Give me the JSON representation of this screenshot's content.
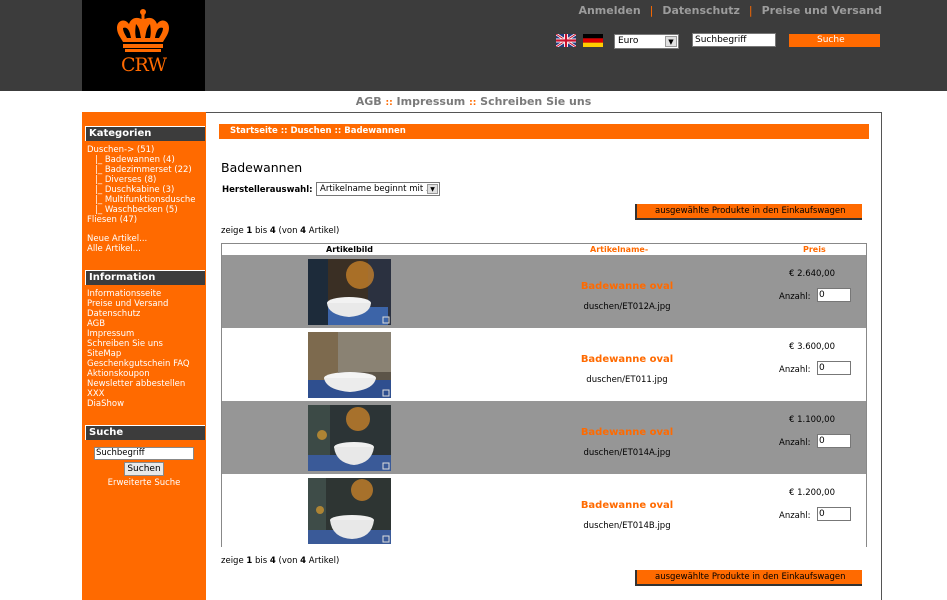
{
  "header": {
    "logo_text": "CRW",
    "top_links": [
      "Anmelden",
      "Datenschutz",
      "Preise und Versand"
    ],
    "currency": "Euro",
    "search_value": "Suchbegriff",
    "search_button": "Suche"
  },
  "secnav": {
    "links": [
      "AGB",
      "Impressum",
      "Schreiben Sie uns"
    ],
    "separator": "::"
  },
  "sidebar": {
    "categories_title": "Kategorien",
    "categories": [
      {
        "label": "Duschen-> (51)",
        "indent": false
      },
      {
        "label": "|_ Badewannen (4)",
        "indent": true
      },
      {
        "label": "|_ Badezimmerset (22)",
        "indent": true
      },
      {
        "label": "|_ Diverses (8)",
        "indent": true
      },
      {
        "label": "|_ Duschkabine (3)",
        "indent": true
      },
      {
        "label": "|_ Multifunktionsdusche",
        "indent": true
      },
      {
        "label": "|_ Waschbecken (5)",
        "indent": true
      },
      {
        "label": "Fliesen (47)",
        "indent": false
      }
    ],
    "new_products": "Neue Artikel...",
    "all_products": "Alle Artikel...",
    "information_title": "Information",
    "information": [
      "Informationsseite",
      "Preise und Versand",
      "Datenschutz",
      "AGB",
      "Impressum",
      "Schreiben Sie uns",
      "SiteMap",
      "Geschenkgutschein FAQ",
      "Aktionskoupon",
      "Newsletter abbestellen",
      "XXX",
      "DiaShow"
    ],
    "search_title": "Suche",
    "search_value": "Suchbegriff",
    "search_button": "Suchen",
    "advanced_search": "Erweiterte Suche"
  },
  "main": {
    "breadcrumb": "Startseite :: Duschen :: Badewannen",
    "title": "Badewannen",
    "manufacturer_label": "Herstellerauswahl:",
    "manufacturer_select": "Artikelname beginnt mit ...",
    "cart_button": "ausgewählte Produkte in den Einkaufswagen",
    "count_prefix": "zeige ",
    "count_from": "1",
    "count_mid": " bis ",
    "count_to": "4",
    "count_suffix_pre": " (von ",
    "count_total": "4",
    "count_suffix": " Artikel)",
    "table_headers": {
      "image": "Artikelbild",
      "name": "Artikelname-",
      "price": "Preis"
    },
    "qty_label": "Anzahl:",
    "products": [
      {
        "name": "Badewanne oval",
        "file": "duschen/ET012A.jpg",
        "price": "€ 2.640,00",
        "qty": "0"
      },
      {
        "name": "Badewanne oval",
        "file": "duschen/ET011.jpg",
        "price": "€ 3.600,00",
        "qty": "0"
      },
      {
        "name": "Badewanne oval",
        "file": "duschen/ET014A.jpg",
        "price": "€ 1.100,00",
        "qty": "0"
      },
      {
        "name": "Badewanne oval",
        "file": "duschen/ET014B.jpg",
        "price": "€ 1.200,00",
        "qty": "0"
      }
    ]
  },
  "colors": {
    "accent": "#ff6a00",
    "header_bg": "#3c3c3c",
    "row_grey": "#969696"
  }
}
